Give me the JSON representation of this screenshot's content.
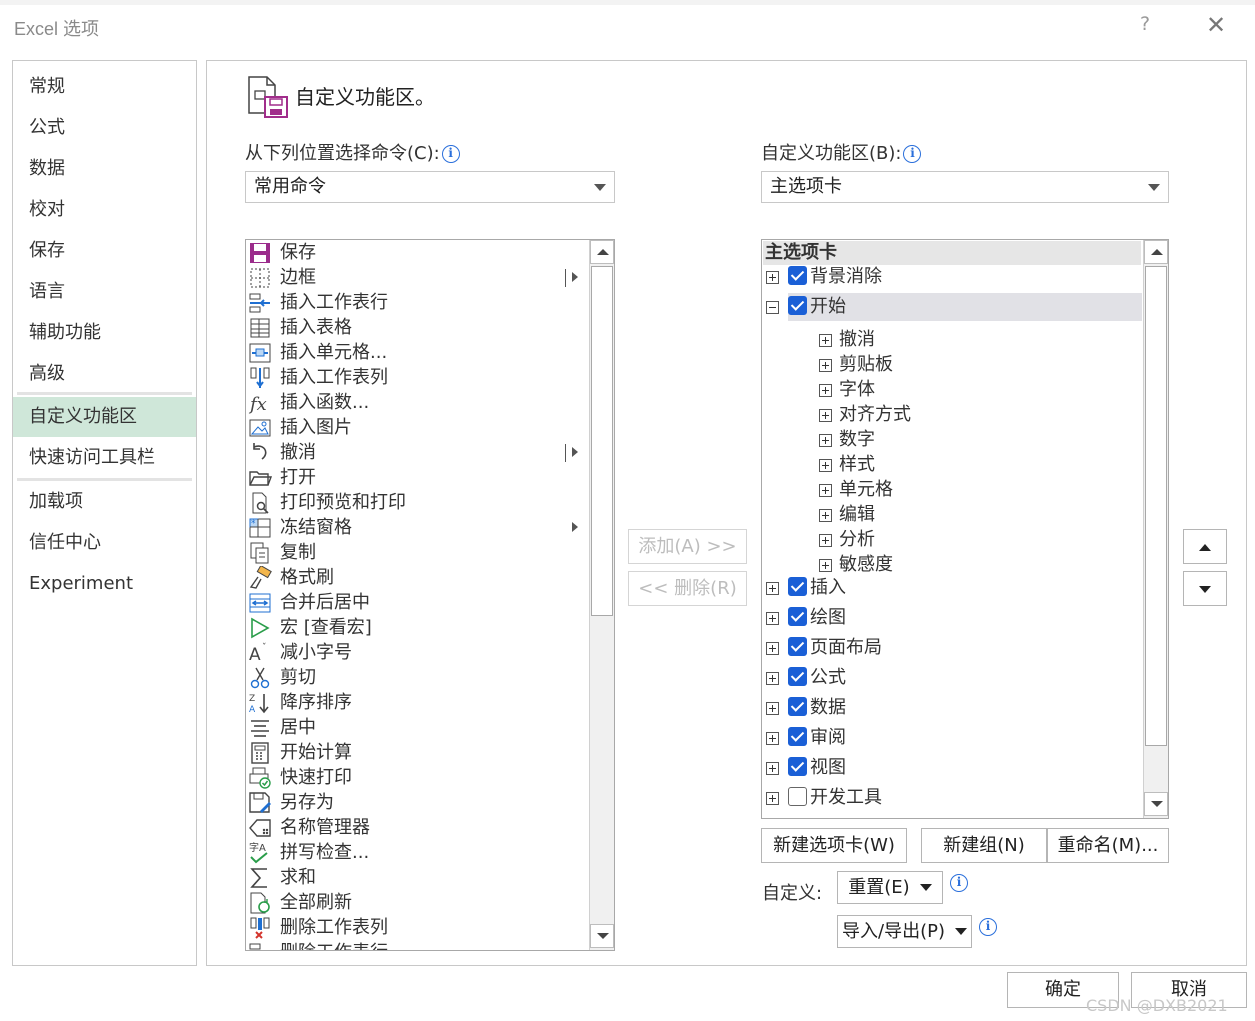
{
  "window": {
    "title": "Excel 选项",
    "help": "?",
    "close": "✕"
  },
  "nav": {
    "items": [
      {
        "label": "常规"
      },
      {
        "label": "公式"
      },
      {
        "label": "数据"
      },
      {
        "label": "校对"
      },
      {
        "label": "保存"
      },
      {
        "label": "语言"
      },
      {
        "label": "辅助功能"
      },
      {
        "label": "高级"
      },
      {
        "label": "自定义功能区"
      },
      {
        "label": "快速访问工具栏"
      },
      {
        "label": "加载项"
      },
      {
        "label": "信任中心"
      },
      {
        "label": "Experiment"
      }
    ],
    "active_index": 8
  },
  "page": {
    "title": "自定义功能区。",
    "choose_from_label": "从下列位置选择命令(C):",
    "choose_from_value": "常用命令",
    "customize_label": "自定义功能区(B):",
    "customize_value": "主选项卡"
  },
  "commands": [
    {
      "label": "保存",
      "icon": "save-icon"
    },
    {
      "label": "边框",
      "icon": "border-icon",
      "submenu": "bar"
    },
    {
      "label": "插入工作表行",
      "icon": "insert-row-icon"
    },
    {
      "label": "插入表格",
      "icon": "insert-table-icon"
    },
    {
      "label": "插入单元格...",
      "icon": "insert-cells-icon"
    },
    {
      "label": "插入工作表列",
      "icon": "insert-column-icon"
    },
    {
      "label": "插入函数...",
      "icon": "function-icon"
    },
    {
      "label": "插入图片",
      "icon": "picture-icon"
    },
    {
      "label": "撤消",
      "icon": "undo-icon",
      "submenu": "bar"
    },
    {
      "label": "打开",
      "icon": "open-folder-icon"
    },
    {
      "label": "打印预览和打印",
      "icon": "print-preview-icon"
    },
    {
      "label": "冻结窗格",
      "icon": "freeze-panes-icon",
      "submenu": "arrow"
    },
    {
      "label": "复制",
      "icon": "copy-icon"
    },
    {
      "label": "格式刷",
      "icon": "format-painter-icon"
    },
    {
      "label": "合并后居中",
      "icon": "merge-center-icon"
    },
    {
      "label": "宏 [查看宏]",
      "icon": "macro-icon"
    },
    {
      "label": "减小字号",
      "icon": "decrease-font-icon"
    },
    {
      "label": "剪切",
      "icon": "cut-icon"
    },
    {
      "label": "降序排序",
      "icon": "sort-descending-icon"
    },
    {
      "label": "居中",
      "icon": "center-align-icon"
    },
    {
      "label": "开始计算",
      "icon": "calculator-icon"
    },
    {
      "label": "快速打印",
      "icon": "quick-print-icon"
    },
    {
      "label": "另存为",
      "icon": "save-as-icon"
    },
    {
      "label": "名称管理器",
      "icon": "name-manager-icon"
    },
    {
      "label": "拼写检查...",
      "icon": "spelling-icon"
    },
    {
      "label": "求和",
      "icon": "sum-icon"
    },
    {
      "label": "全部刷新",
      "icon": "refresh-all-icon"
    },
    {
      "label": "删除工作表列",
      "icon": "delete-column-icon"
    },
    {
      "label": "删除工作表行",
      "icon": "delete-row-icon"
    }
  ],
  "tree": {
    "header": "主选项卡",
    "items": [
      {
        "label": "背景消除",
        "level": 0,
        "expander": "plus",
        "checked": true
      },
      {
        "label": "开始",
        "level": 0,
        "expander": "minus",
        "checked": true,
        "selected": true
      },
      {
        "label": "撤消",
        "level": 1,
        "expander": "plus"
      },
      {
        "label": "剪贴板",
        "level": 1,
        "expander": "plus"
      },
      {
        "label": "字体",
        "level": 1,
        "expander": "plus"
      },
      {
        "label": "对齐方式",
        "level": 1,
        "expander": "plus"
      },
      {
        "label": "数字",
        "level": 1,
        "expander": "plus"
      },
      {
        "label": "样式",
        "level": 1,
        "expander": "plus"
      },
      {
        "label": "单元格",
        "level": 1,
        "expander": "plus"
      },
      {
        "label": "编辑",
        "level": 1,
        "expander": "plus"
      },
      {
        "label": "分析",
        "level": 1,
        "expander": "plus"
      },
      {
        "label": "敏感度",
        "level": 1,
        "expander": "plus"
      },
      {
        "label": "插入",
        "level": 0,
        "expander": "plus",
        "checked": true
      },
      {
        "label": "绘图",
        "level": 0,
        "expander": "plus",
        "checked": true
      },
      {
        "label": "页面布局",
        "level": 0,
        "expander": "plus",
        "checked": true
      },
      {
        "label": "公式",
        "level": 0,
        "expander": "plus",
        "checked": true
      },
      {
        "label": "数据",
        "level": 0,
        "expander": "plus",
        "checked": true
      },
      {
        "label": "审阅",
        "level": 0,
        "expander": "plus",
        "checked": true
      },
      {
        "label": "视图",
        "level": 0,
        "expander": "plus",
        "checked": true
      },
      {
        "label": "开发工具",
        "level": 0,
        "expander": "plus",
        "checked": false
      }
    ]
  },
  "buttons": {
    "add": "添加(A) >>",
    "remove": "<< 删除(R)",
    "new_tab": "新建选项卡(W)",
    "new_group": "新建组(N)",
    "rename": "重命名(M)...",
    "customize_label": "自定义:",
    "reset": "重置(E)",
    "import_export": "导入/导出(P)",
    "ok": "确定",
    "cancel": "取消"
  },
  "watermark": "CSDN @DXB2021"
}
